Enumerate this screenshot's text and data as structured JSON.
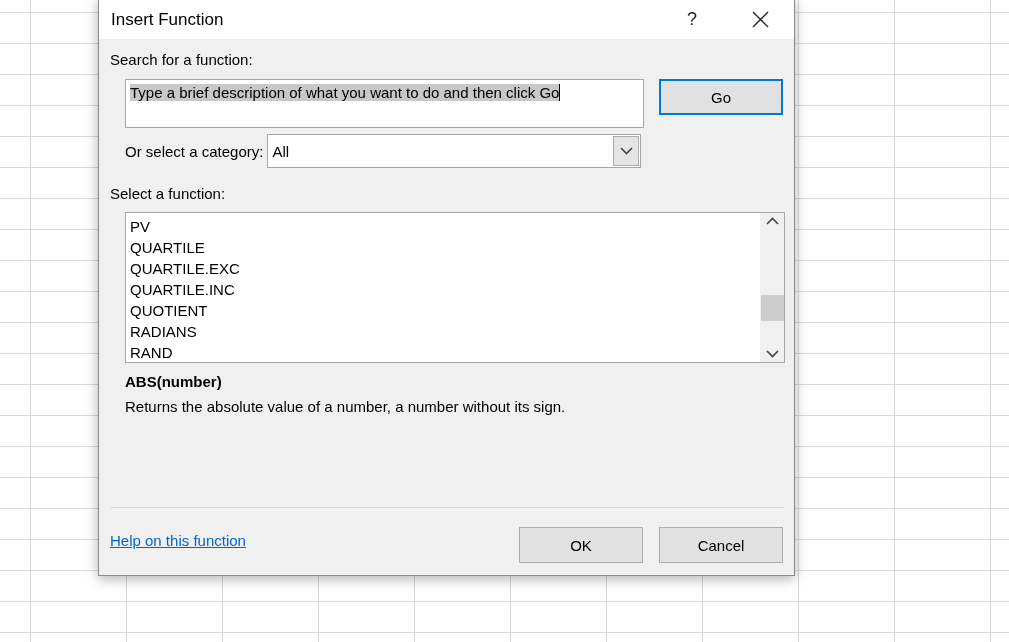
{
  "dialog": {
    "title": "Insert Function",
    "help_button": "?"
  },
  "search": {
    "label": "Search for a function:",
    "value": "Type a brief description of what you want to do and then click Go",
    "highlighted": true
  },
  "go_button": {
    "label": "Go",
    "focused": true
  },
  "category": {
    "label": "Or select a category:",
    "value": "All"
  },
  "function_list": {
    "label": "Select a function:",
    "items": [
      {
        "label": "PV",
        "selected": false
      },
      {
        "label": "QUARTILE",
        "selected": false
      },
      {
        "label": "QUARTILE.EXC",
        "selected": false
      },
      {
        "label": "QUARTILE.INC",
        "selected": false
      },
      {
        "label": "QUOTIENT",
        "selected": false
      },
      {
        "label": "RADIANS",
        "selected": false
      },
      {
        "label": "RAND",
        "selected": false
      }
    ]
  },
  "signature": "ABS(number)",
  "description": "Returns the absolute value of a number, a number without its sign.",
  "help_link": "Help on this function",
  "buttons": [
    {
      "label": "OK",
      "focused": false
    },
    {
      "label": "Cancel",
      "focused": false
    }
  ]
}
